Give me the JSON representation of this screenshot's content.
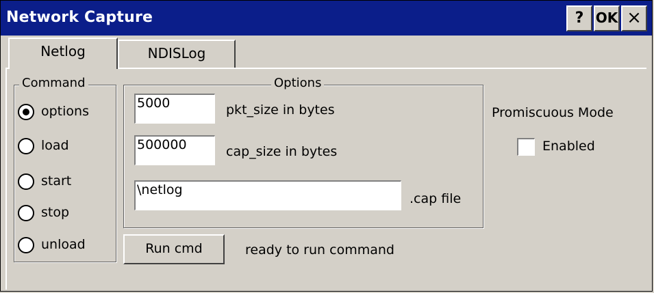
{
  "window": {
    "title": "Network Capture",
    "help_label": "?",
    "ok_label": "OK",
    "close_label": "×"
  },
  "tabs": [
    {
      "label": "Netlog",
      "selected": true
    },
    {
      "label": "NDISLog",
      "selected": false
    }
  ],
  "command_group": {
    "legend": "Command",
    "options": [
      {
        "label": "options",
        "selected": true
      },
      {
        "label": "load",
        "selected": false
      },
      {
        "label": "start",
        "selected": false
      },
      {
        "label": "stop",
        "selected": false
      },
      {
        "label": "unload",
        "selected": false
      }
    ]
  },
  "options_group": {
    "legend": "Options",
    "pkt_size_value": "5000",
    "pkt_size_label": "pkt_size in bytes",
    "cap_size_value": "500000",
    "cap_size_label": "cap_size in bytes",
    "file_value": "\\netlog",
    "file_label": ".cap file"
  },
  "run": {
    "button_label": "Run cmd",
    "status": "ready to run command"
  },
  "promiscuous": {
    "heading": "Promiscuous Mode",
    "checkbox_label": "Enabled",
    "checked": false
  }
}
